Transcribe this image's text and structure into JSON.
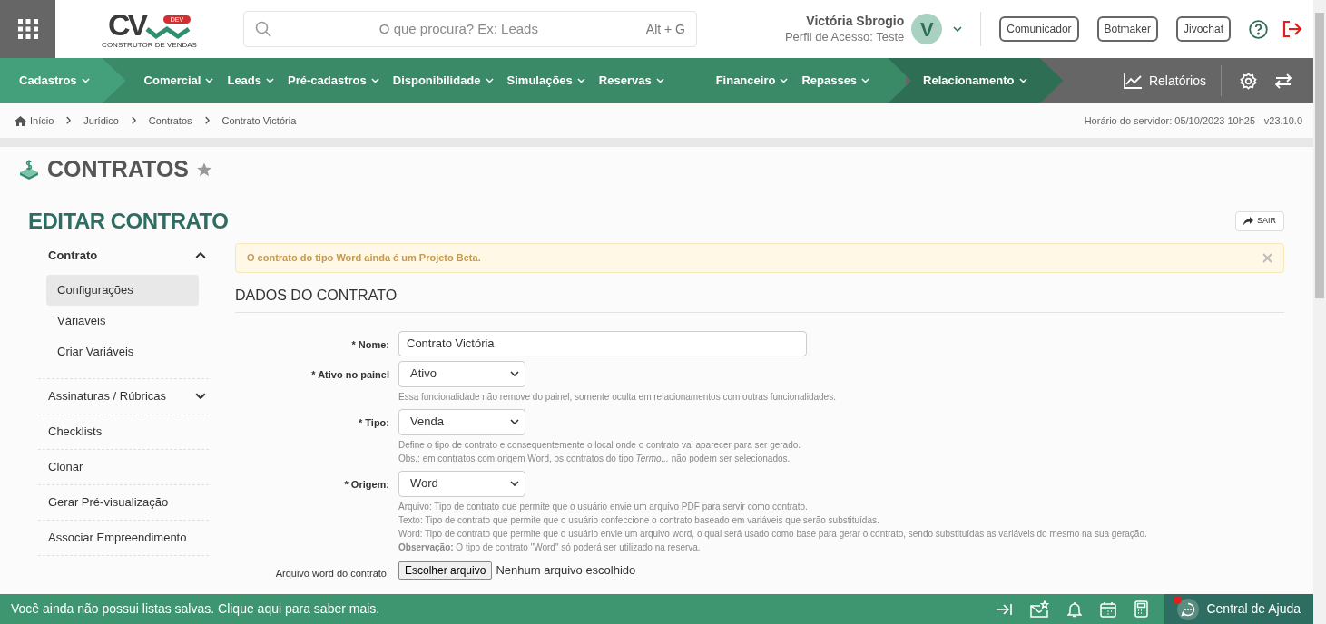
{
  "logo": {
    "text": "CV",
    "badge": "DEV",
    "subtitle": "CONSTRUTOR DE VENDAS"
  },
  "search": {
    "placeholder": "O que procura? Ex: Leads",
    "shortcut": "Alt + G"
  },
  "user": {
    "name": "Victória Sbrogio",
    "profile": "Perfil de Acesso: Teste",
    "initial": "V"
  },
  "header_buttons": [
    "Comunicador",
    "Botmaker",
    "Jivochat"
  ],
  "nav": [
    {
      "label": "Cadastros",
      "kind": "light"
    },
    {
      "label": "Comercial",
      "kind": "plain"
    },
    {
      "label": "Leads",
      "kind": "plain"
    },
    {
      "label": "Pré-cadastros",
      "kind": "plain"
    },
    {
      "label": "Disponibilidade",
      "kind": "plain"
    },
    {
      "label": "Simulações",
      "kind": "plain"
    },
    {
      "label": "Reservas",
      "kind": "plain"
    },
    {
      "label": "Financeiro",
      "kind": "plain"
    },
    {
      "label": "Repasses",
      "kind": "plain"
    },
    {
      "label": "Relacionamento",
      "kind": "dark"
    }
  ],
  "reports": "Relatórios",
  "breadcrumb": [
    "Início",
    "Jurídico",
    "Contratos",
    "Contrato Victória"
  ],
  "server_time": "Horário do servidor: 05/10/2023 10h25 - v23.10.0",
  "page_title": "CONTRATOS",
  "section_title": "EDITAR CONTRATO",
  "exit_button": "SAIR",
  "sidebar": [
    {
      "label": "Contrato",
      "expanded": true,
      "children": [
        {
          "label": "Configurações",
          "selected": true
        },
        {
          "label": "Váriaveis",
          "selected": false
        },
        {
          "label": "Criar Variáveis",
          "selected": false
        }
      ]
    },
    {
      "label": "Assinaturas / Rúbricas",
      "expanded": false
    },
    {
      "label": "Checklists"
    },
    {
      "label": "Clonar"
    },
    {
      "label": "Gerar Pré-visualização"
    },
    {
      "label": "Associar Empreendimento"
    }
  ],
  "alert": "O contrato do tipo Word ainda é um Projeto Beta.",
  "form_title": "DADOS DO CONTRATO",
  "fields": [
    {
      "kind": "text",
      "label": "* Nome:",
      "value": "Contrato Victória"
    },
    {
      "kind": "select",
      "label": "* Ativo no painel",
      "value": "Ativo",
      "help": [
        "Essa funcionalidade não remove do painel, somente oculta em relacionamentos com outras funcionalidades."
      ]
    },
    {
      "kind": "select",
      "label": "* Tipo:",
      "value": "Venda",
      "help": [
        "Define o tipo de contrato e consequentemente o local onde o contrato vai aparecer para ser gerado.",
        "Obs.: em contratos com origem Word, os contratos do tipo *Termo...* não podem ser selecionados."
      ]
    },
    {
      "kind": "select",
      "label": "* Origem:",
      "value": "Word",
      "help": [
        "Arquivo: Tipo de contrato que permite que o usuário envie um arquivo PDF para servir como contrato.",
        "Texto: Tipo de contrato que permite que o usuário confeccione o contrato baseado em variáveis que serão substituídas.",
        "Word: Tipo de contrato que permite que o usuário envie um arquivo word, o qual será usado como base para gerar o contrato, sendo substituídas as variáveis do mesmo na sua geração.",
        "**Observação:** O tipo de contrato \"Word\" só poderá ser utilizado na reserva."
      ]
    },
    {
      "kind": "file",
      "label": "Arquivo word do contrato:",
      "button": "Escolher arquivo",
      "value": "Nenhum arquivo escolhido"
    }
  ],
  "footer": {
    "message": "Você ainda não possui listas salvas. Clique aqui para saber mais.",
    "help": "Central de Ajuda",
    "help_unread": true
  }
}
